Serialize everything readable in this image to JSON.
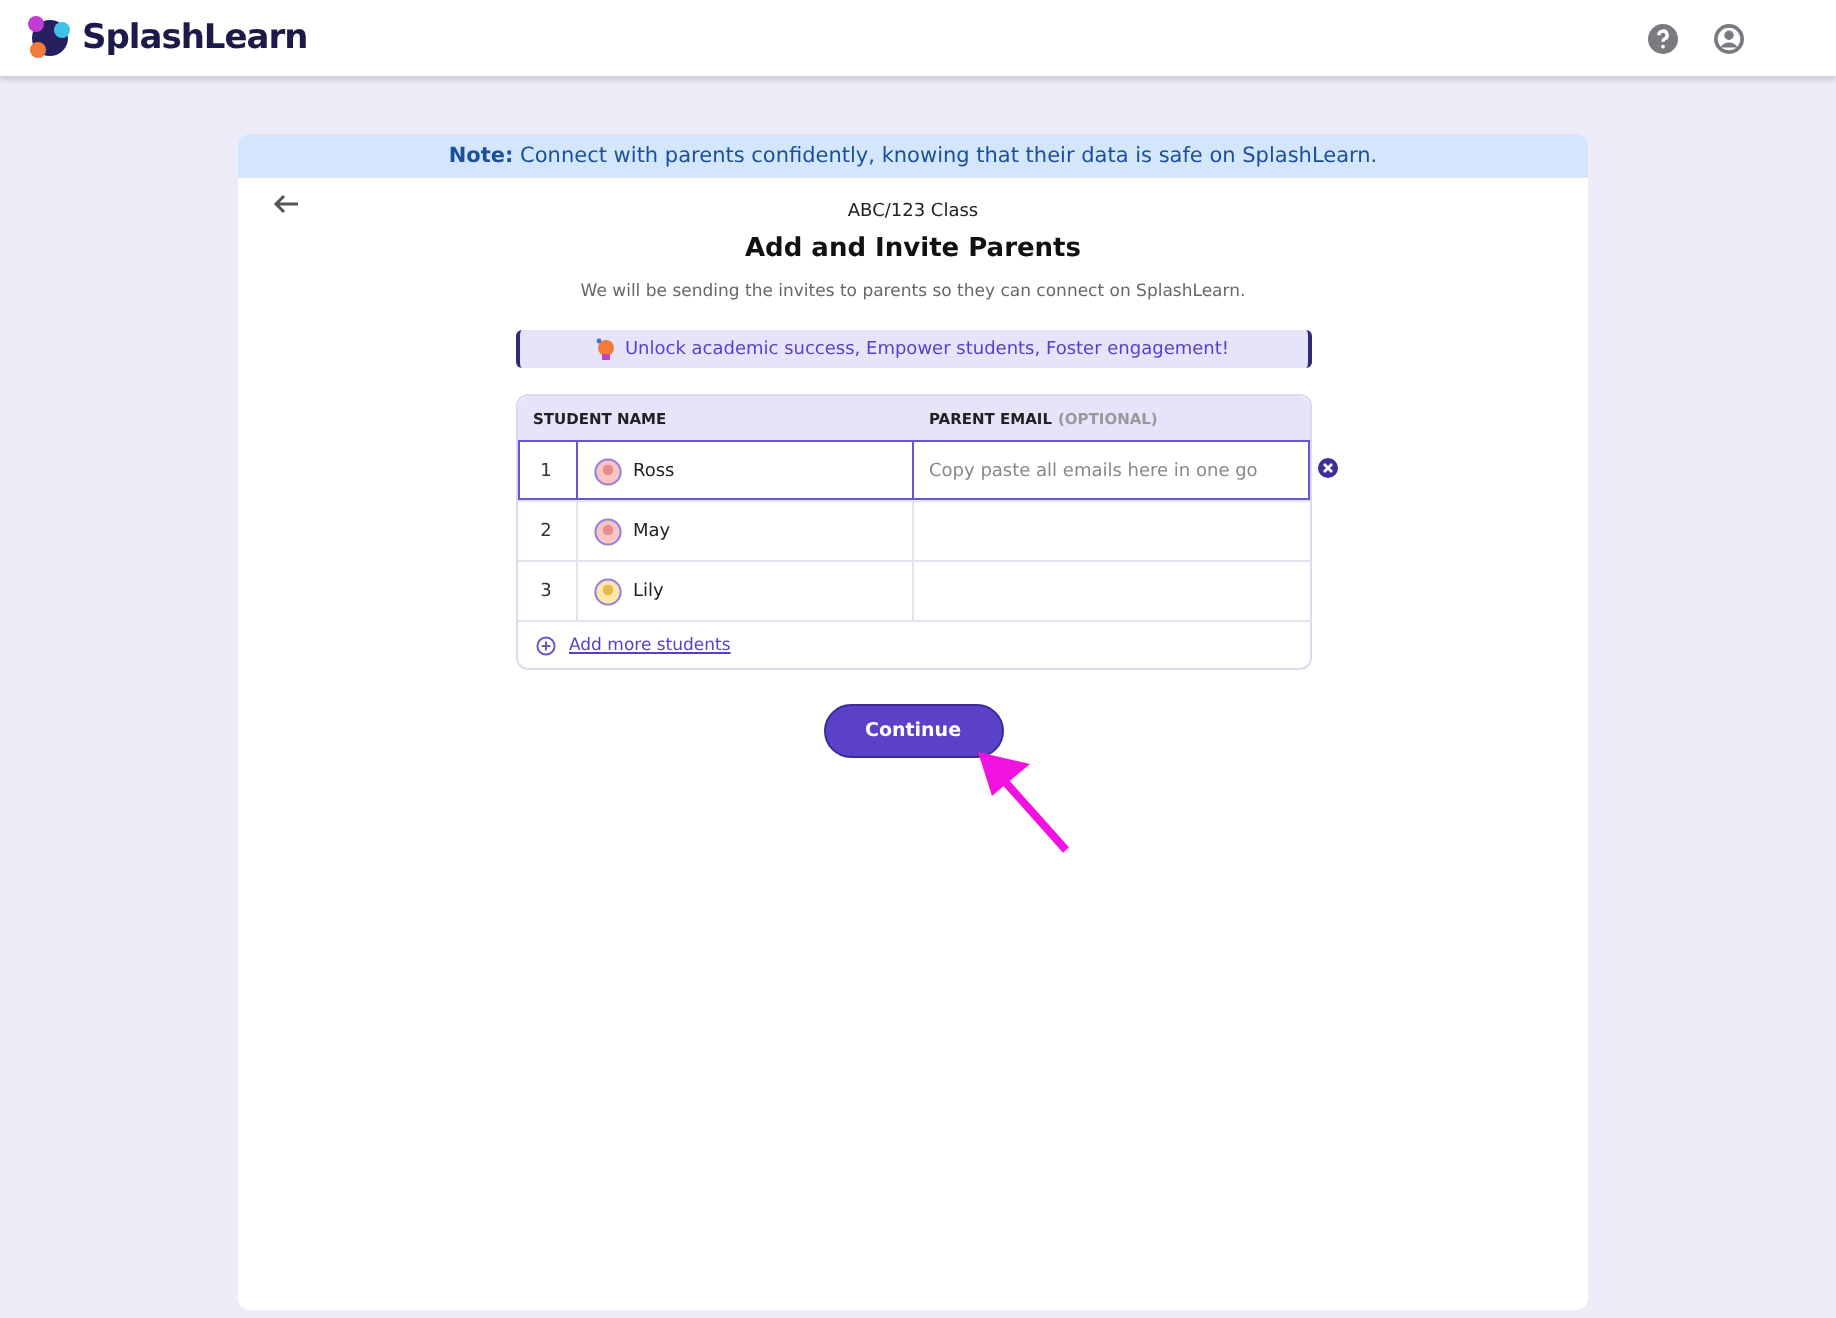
{
  "header": {
    "logo_text": "SplashLearn"
  },
  "note": "**Note:** Connect with parents confidently, knowing that their data is safe on SplashLearn.",
  "class_name": "ABC/123 Class",
  "title": "Add and Invite Parents",
  "subtitle": "We will be sending the invites to parents so they can connect on SplashLearn.",
  "banner": "Unlock academic success, Empower students, Foster engagement!",
  "table": {
    "columns": [
      {
        "label": "STUDENT NAME"
      },
      {
        "label": "PARENT EMAIL",
        "hint": "(OPTIONAL)"
      }
    ],
    "rows": [
      {
        "number": "1",
        "name": "Ross",
        "selected": true,
        "placeholder": "Copy paste all emails here in one go"
      },
      {
        "number": "2",
        "name": "May",
        "selected": false
      },
      {
        "number": "3",
        "name": "Lily",
        "selected": false
      }
    ],
    "add_link": "Add more students"
  },
  "continue_button": "Continue"
}
